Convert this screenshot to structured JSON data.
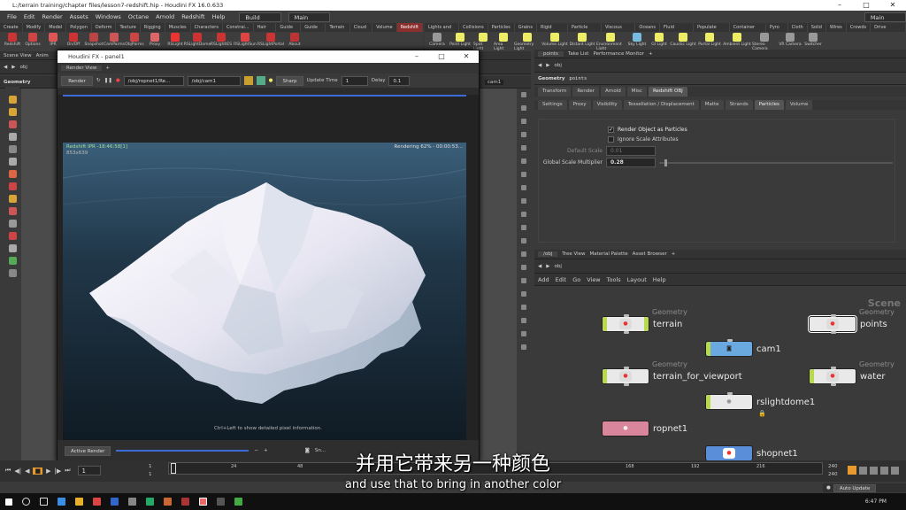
{
  "window": {
    "title": "L:/terrain training/chapter files/lesson7-redshift.hip - Houdini FX 16.0.633"
  },
  "menubar": {
    "items": [
      "File",
      "Edit",
      "Render",
      "Assets",
      "Windows",
      "Octane",
      "Arnold",
      "Redshift",
      "Help"
    ],
    "desktop_left": "Build",
    "desktop_mid": "Main",
    "desktop_right": "Main"
  },
  "left_shelf": {
    "tabs": [
      "Create",
      "Modify",
      "Model",
      "Polygon",
      "Deform",
      "Texture",
      "Rigging",
      "Muscles",
      "Characters",
      "Constrai...",
      "Hair Utils",
      "Guide Pr...",
      "Guide Br...",
      "Terrain FX",
      "Cloud FX",
      "Volume",
      "Redshift"
    ],
    "active_tab": "Redshift",
    "tools": [
      "Redshift",
      "Options",
      "IPR",
      "On/Off",
      "Snapshot",
      "CamParms",
      "ObjParms",
      "Proxy",
      "RSLight",
      "RSLightDome",
      "RSLightIES",
      "RSLightSun",
      "RSLightPortal",
      "About"
    ]
  },
  "right_shelf": {
    "tabs": [
      "Lights and C...",
      "Collisions",
      "Particles",
      "Grains",
      "Rigid Bodies",
      "Particle Fluids",
      "Viscous Fluids",
      "Oceans",
      "Fluid Contai...",
      "Populate Con...",
      "Container Tools",
      "Pyro FX",
      "Cloth",
      "Solid",
      "Wires",
      "Crowds",
      "Drive Simula..."
    ],
    "tools": [
      "Camera",
      "Point Light",
      "Spot Light",
      "Area Light",
      "Geometry Light",
      "Volume Light",
      "Distant Light",
      "Environment Light",
      "Sky Light",
      "GI Light",
      "Caustic Light",
      "Portal Light",
      "Ambient Light",
      "Stereo Camera",
      "VR Camera",
      "Switcher"
    ]
  },
  "scene_view": {
    "tab_label": "Scene View",
    "tab2": "Anim",
    "path": "obj",
    "context": "Geometry",
    "camera": "cam1"
  },
  "render_window": {
    "title": "Houdini FX - panel1",
    "tab": "Render View",
    "render_btn": "Render",
    "rop_path": "/obj/ropnet1/Re...",
    "cam_path": "/obj/cam1",
    "sharp": "Sharp",
    "update_time_label": "Update Time",
    "update_time": "1",
    "delay_label": "Delay",
    "delay": "0.1",
    "status_left": "Redshift IPR -18:46:58[1]",
    "status_res": "853x639",
    "status_right": "Rendering 62% - 00:00:53...",
    "hint": "Ctrl+Left to show detailed pixel information.",
    "active_render": "Active Render",
    "snap_label": "Sn..."
  },
  "params": {
    "tab_points": "points",
    "tab_take": "Take List",
    "tab_perf": "Performance Monitor",
    "path": "obj",
    "node_type": "Geometry",
    "node_name": "points",
    "tabs": [
      "Transform",
      "Render",
      "Arnold",
      "Misc",
      "Redshift OBJ"
    ],
    "subtabs": [
      "Settings",
      "Proxy",
      "Visibility",
      "Tessellation / Displacement",
      "Matte",
      "Strands",
      "Particles",
      "Volume"
    ],
    "active_subtab": "Particles",
    "render_as_particles": "Render Object as Particles",
    "ignore_scale": "Ignore Scale Attributes",
    "default_scale_label": "Default Scale",
    "default_scale": "0.01",
    "global_scale_label": "Global Scale Multiplier",
    "global_scale": "0.28"
  },
  "network": {
    "tabs": [
      "/obj",
      "Tree View",
      "Material Palette",
      "Asset Browser"
    ],
    "path": "obj",
    "menu": [
      "Add",
      "Edit",
      "Go",
      "View",
      "Tools",
      "Layout",
      "Help"
    ],
    "scene_label": "Scene",
    "nodes": [
      {
        "type": "Geometry",
        "label": "terrain"
      },
      {
        "type": "Geometry",
        "label": "points"
      },
      {
        "type": "",
        "label": "cam1"
      },
      {
        "type": "Geometry",
        "label": "terrain_for_viewport"
      },
      {
        "type": "Geometry",
        "label": "water"
      },
      {
        "type": "",
        "label": "rslightdome1"
      },
      {
        "type": "",
        "label": "ropnet1"
      },
      {
        "type": "",
        "label": "shopnet1"
      }
    ]
  },
  "timeline": {
    "frame": "1",
    "start": "1",
    "start2": "1",
    "ticks": [
      "24",
      "48",
      "168",
      "192",
      "216"
    ],
    "end": "240",
    "end2": "240",
    "auto_update": "Auto Update"
  },
  "subtitles": {
    "cn": "并用它带来另一种颜色",
    "en": "and use that to bring in another color"
  },
  "taskbar": {
    "clock": "6:47 PM"
  },
  "colors": {
    "geo_green": "#b7d94a",
    "geo_white": "#e9e9e9",
    "cam_blue": "#6aa8e0",
    "rop_pink": "#d9869c",
    "shop_blue": "#5a8ed8",
    "redshift_tab": "#8a2e2e"
  }
}
